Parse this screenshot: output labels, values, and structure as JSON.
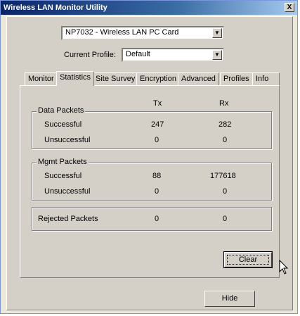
{
  "window": {
    "title": "Wireless LAN Monitor Utility",
    "close_label": "X"
  },
  "device": {
    "selected": "NP7032 - Wireless LAN PC Card"
  },
  "profile": {
    "label": "Current Profile:",
    "selected": "Default"
  },
  "tabs": [
    {
      "label": "Monitor",
      "active": false
    },
    {
      "label": "Statistics",
      "active": true
    },
    {
      "label": "Site Survey",
      "active": false
    },
    {
      "label": "Encryption",
      "active": false
    },
    {
      "label": "Advanced",
      "active": false
    },
    {
      "label": "Profiles",
      "active": false
    },
    {
      "label": "Info",
      "active": false
    }
  ],
  "columns": {
    "tx": "Tx",
    "rx": "Rx"
  },
  "data_packets": {
    "title": "Data Packets",
    "rows": [
      {
        "label": "Successful",
        "tx": "247",
        "rx": "282"
      },
      {
        "label": "Unsuccessful",
        "tx": "0",
        "rx": "0"
      }
    ]
  },
  "mgmt_packets": {
    "title": "Mgmt Packets",
    "rows": [
      {
        "label": "Successful",
        "tx": "88",
        "rx": "177618"
      },
      {
        "label": "Unsuccessful",
        "tx": "0",
        "rx": "0"
      }
    ]
  },
  "rejected": {
    "label": "Rejected Packets",
    "tx": "0",
    "rx": "0"
  },
  "buttons": {
    "clear": "Clear",
    "hide": "Hide"
  },
  "icons": {
    "dropdown": "chevron-down-icon",
    "cursor": "mouse-pointer-icon"
  }
}
